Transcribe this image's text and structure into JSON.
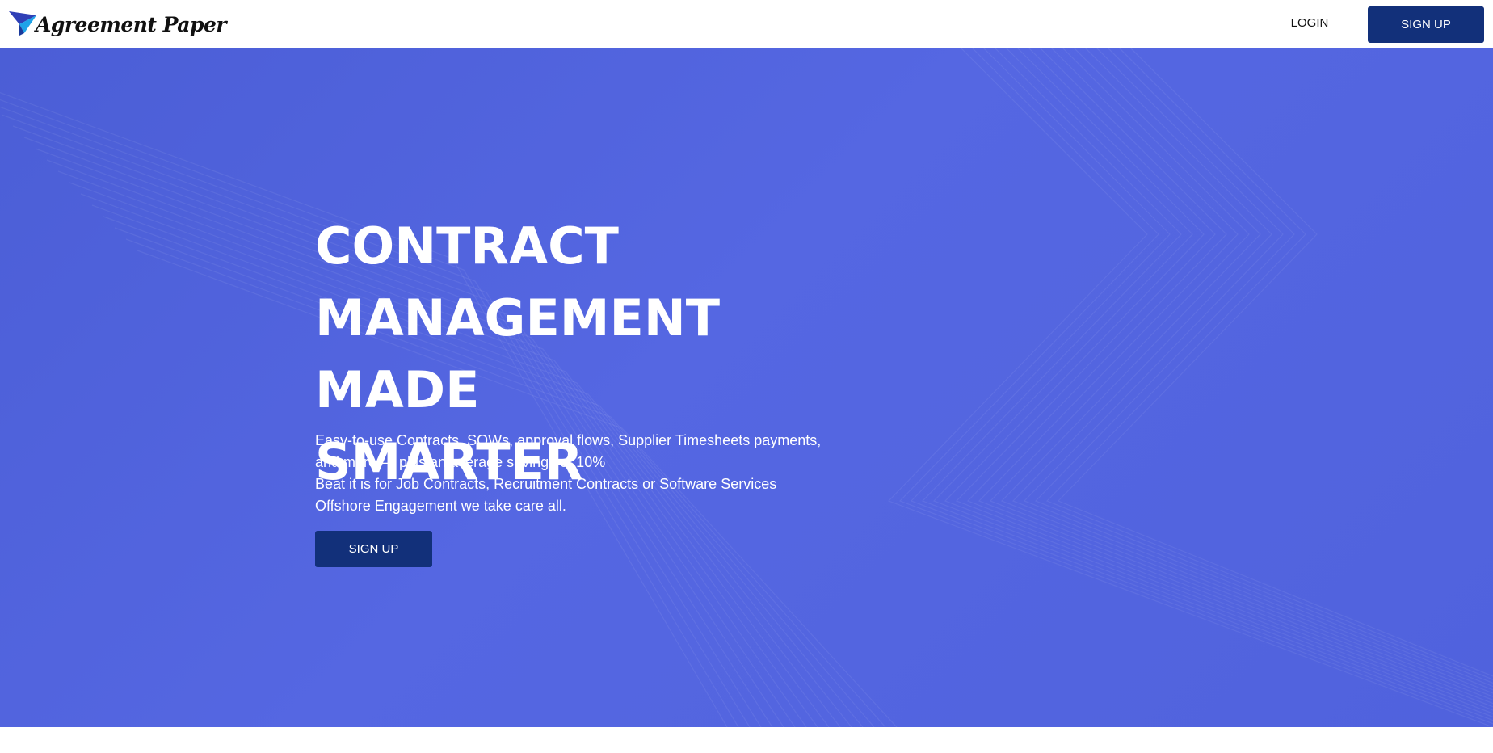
{
  "header": {
    "logo_text": "Agreement Paper",
    "login_label": "LOGIN",
    "signup_label": "SIGN UP"
  },
  "hero": {
    "title_lines": [
      "CONTRACT",
      "MANAGEMENT MADE",
      "SMARTER"
    ],
    "description_lines": [
      "Easy-to-use Contracts, SOWs, approval flows, Supplier Timesheets payments,",
      "and more — plus an average savings of 10%",
      "Beat it is for Job Contracts, Recruitment Contracts or Software Services",
      "Offshore Engagement we take care all."
    ],
    "signup_label": "SIGN UP"
  },
  "colors": {
    "hero_background": "#5264e0",
    "button_background": "#12307a",
    "button_text": "#ffffff"
  },
  "icons": {
    "logo": "paper-plane-icon"
  }
}
